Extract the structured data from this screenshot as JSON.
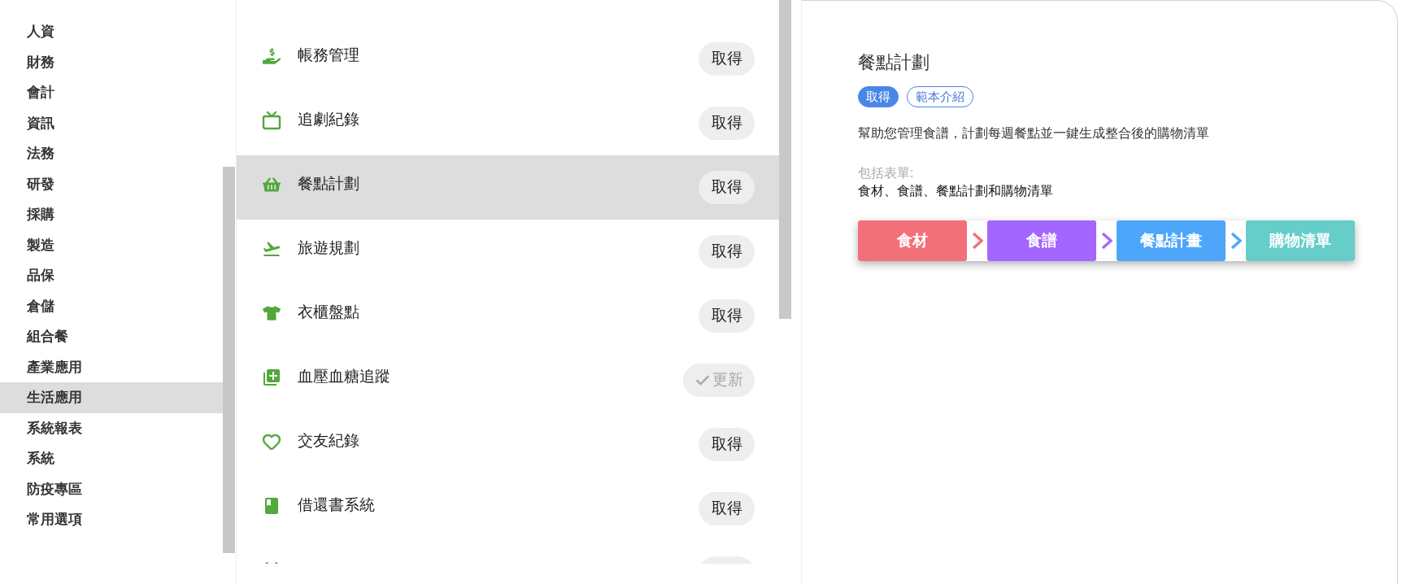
{
  "sidebar": {
    "items": [
      {
        "label": "人資",
        "selected": false
      },
      {
        "label": "財務",
        "selected": false
      },
      {
        "label": "會計",
        "selected": false
      },
      {
        "label": "資訊",
        "selected": false
      },
      {
        "label": "法務",
        "selected": false
      },
      {
        "label": "研發",
        "selected": false
      },
      {
        "label": "採購",
        "selected": false
      },
      {
        "label": "製造",
        "selected": false
      },
      {
        "label": "品保",
        "selected": false
      },
      {
        "label": "倉儲",
        "selected": false
      },
      {
        "label": "組合餐",
        "selected": false
      },
      {
        "label": "產業應用",
        "selected": false
      },
      {
        "label": "生活應用",
        "selected": true
      },
      {
        "label": "系統報表",
        "selected": false
      },
      {
        "label": "系統",
        "selected": false
      },
      {
        "label": "防疫專區",
        "selected": false
      },
      {
        "label": "常用選項",
        "selected": false
      }
    ]
  },
  "templates": {
    "rows": [
      {
        "title": "帳務管理",
        "selected": false,
        "button": {
          "label": "取得",
          "disabled": false
        }
      },
      {
        "title": "追劇紀錄",
        "selected": false,
        "button": {
          "label": "取得",
          "disabled": false
        }
      },
      {
        "title": "餐點計劃",
        "selected": true,
        "button": {
          "label": "取得",
          "disabled": false
        }
      },
      {
        "title": "旅遊規劃",
        "selected": false,
        "button": {
          "label": "取得",
          "disabled": false
        }
      },
      {
        "title": "衣櫃盤點",
        "selected": false,
        "button": {
          "label": "取得",
          "disabled": false
        }
      },
      {
        "title": "血壓血糖追蹤",
        "selected": false,
        "button": {
          "label": "更新",
          "disabled": true
        }
      },
      {
        "title": "交友紀錄",
        "selected": false,
        "button": {
          "label": "取得",
          "disabled": false
        }
      },
      {
        "title": "借還書系統",
        "selected": false,
        "button": {
          "label": "取得",
          "disabled": false
        }
      },
      {
        "selected": false,
        "button": {
          "disabled": false
        }
      }
    ]
  },
  "detail": {
    "title": "餐點計劃",
    "actions": [
      {
        "label": "取得",
        "kind": "primary"
      },
      {
        "label": "範本介紹",
        "kind": "outline"
      }
    ],
    "description": "幫助您管理食譜，計劃每週餐點並一鍵生成整合後的購物清單",
    "forms_label": "包括表單:",
    "forms": "食材、食譜、餐點計劃和購物清單",
    "flow": [
      {
        "label": "食材",
        "color": "#f2707a"
      },
      {
        "label": "食譜",
        "color": "#a366ff"
      },
      {
        "label": "餐點計畫",
        "color": "#4da6fa"
      },
      {
        "label": "購物清單",
        "color": "#66cdc9"
      }
    ]
  }
}
